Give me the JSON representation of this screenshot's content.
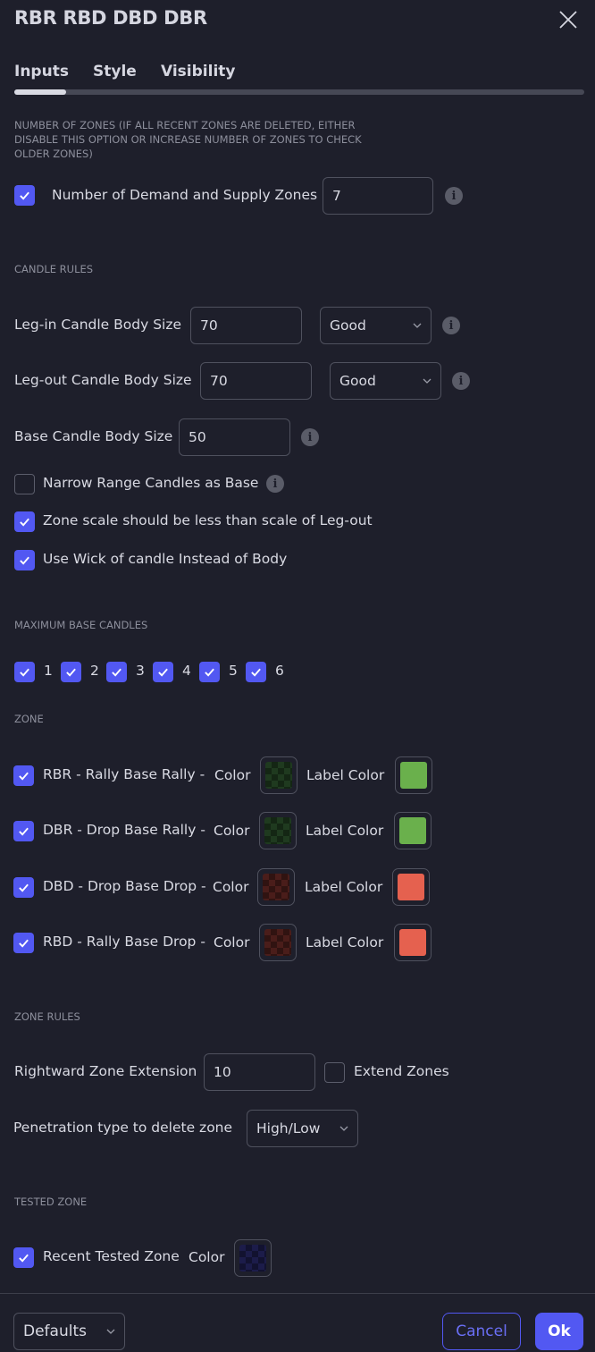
{
  "dialog": {
    "title": "RBR RBD DBD DBR",
    "close_icon": "close-icon"
  },
  "tabs": [
    {
      "label": "Inputs",
      "active": true
    },
    {
      "label": "Style",
      "active": false
    },
    {
      "label": "Visibility",
      "active": false
    }
  ],
  "sections": {
    "number_of_zones": "NUMBER OF ZONES (IF ALL RECENT ZONES ARE DELETED, EITHER DISABLE THIS OPTION OR INCREASE NUMBER OF ZONES TO CHECK OLDER ZONES)",
    "candle_rules": "CANDLE RULES",
    "max_base_candles": "MAXIMUM BASE CANDLES",
    "zone": "ZONE",
    "zone_rules": "ZONE RULES",
    "tested_zone": "TESTED ZONE"
  },
  "zones_count": {
    "checked": true,
    "label": "Number of Demand and Supply Zones",
    "value": "7"
  },
  "candle_rules": {
    "leg_in": {
      "label": "Leg-in Candle Body Size",
      "value": "70",
      "select": "Good"
    },
    "leg_out": {
      "label": "Leg-out Candle Body Size",
      "value": "70",
      "select": "Good"
    },
    "base": {
      "label": "Base Candle Body Size",
      "value": "50"
    },
    "narrow_range": {
      "label": "Narrow Range Candles as Base",
      "checked": false
    },
    "zone_scale": {
      "label": "Zone scale should be less than scale of Leg-out",
      "checked": true
    },
    "use_wick": {
      "label": "Use Wick of candle Instead of Body",
      "checked": true
    }
  },
  "max_base_candles": [
    {
      "label": "1",
      "checked": true
    },
    {
      "label": "2",
      "checked": true
    },
    {
      "label": "3",
      "checked": true
    },
    {
      "label": "4",
      "checked": true
    },
    {
      "label": "5",
      "checked": true
    },
    {
      "label": "6",
      "checked": true
    }
  ],
  "zones": [
    {
      "label": "RBR - Rally Base Rally -",
      "checked": true,
      "color_label": "Color",
      "label_color_label": "Label Color",
      "zone_color": "#1f3a1f",
      "label_color": "#6ab04c"
    },
    {
      "label": "DBR - Drop Base Rally -",
      "checked": true,
      "color_label": "Color",
      "label_color_label": "Label Color",
      "zone_color": "#1f3a1f",
      "label_color": "#6ab04c"
    },
    {
      "label": "DBD - Drop Base Drop -",
      "checked": true,
      "color_label": "Color",
      "label_color_label": "Label Color",
      "zone_color": "#4a1d1a",
      "label_color": "#e5614f"
    },
    {
      "label": "RBD - Rally Base Drop -",
      "checked": true,
      "color_label": "Color",
      "label_color_label": "Label Color",
      "zone_color": "#4a1d1a",
      "label_color": "#e5614f"
    }
  ],
  "zone_rules": {
    "extension": {
      "label": "Rightward Zone Extension",
      "value": "10"
    },
    "extend_zones": {
      "label": "Extend Zones",
      "checked": false
    },
    "penetration": {
      "label": "Penetration type to delete zone",
      "select": "High/Low"
    }
  },
  "tested_zone": {
    "label": "Recent Tested Zone",
    "checked": true,
    "color_label": "Color",
    "zone_color": "#1c1c4a"
  },
  "footer": {
    "defaults_label": "Defaults",
    "cancel_label": "Cancel",
    "ok_label": "Ok"
  },
  "colors": {
    "accent": "#5258f2",
    "background": "#1e1f2b"
  }
}
